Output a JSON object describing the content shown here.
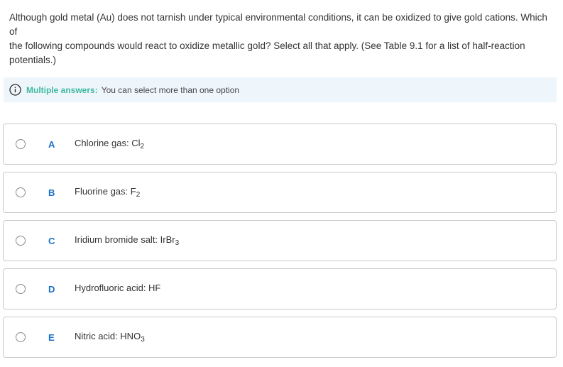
{
  "question": {
    "line1": "Although gold metal (Au) does not tarnish under typical environmental conditions, it can be oxidized to give gold cations. Which of",
    "line2": "the following compounds would react to oxidize metallic gold? Select all that apply. (See Table 9.1 for a list of half-reaction",
    "line3": "potentials.)"
  },
  "banner": {
    "icon": "info-icon",
    "title": "Multiple answers:",
    "text": "You can select more than one option",
    "accent_color": "#3fb9a0",
    "background": "#eef6fc"
  },
  "options": [
    {
      "letter": "A",
      "text": "Chlorine gas: Cl",
      "sub": "2",
      "selected": false
    },
    {
      "letter": "B",
      "text": "Fluorine gas: F",
      "sub": "2",
      "selected": false
    },
    {
      "letter": "C",
      "text": "Iridium bromide salt: IrBr",
      "sub": "3",
      "selected": false
    },
    {
      "letter": "D",
      "text": "Hydrofluoric acid: HF",
      "sub": "",
      "selected": false
    },
    {
      "letter": "E",
      "text": "Nitric acid: HNO",
      "sub": "3",
      "selected": false
    }
  ],
  "colors": {
    "letter": "#1a6fc4",
    "border": "#c9c9c9",
    "text": "#333333"
  }
}
